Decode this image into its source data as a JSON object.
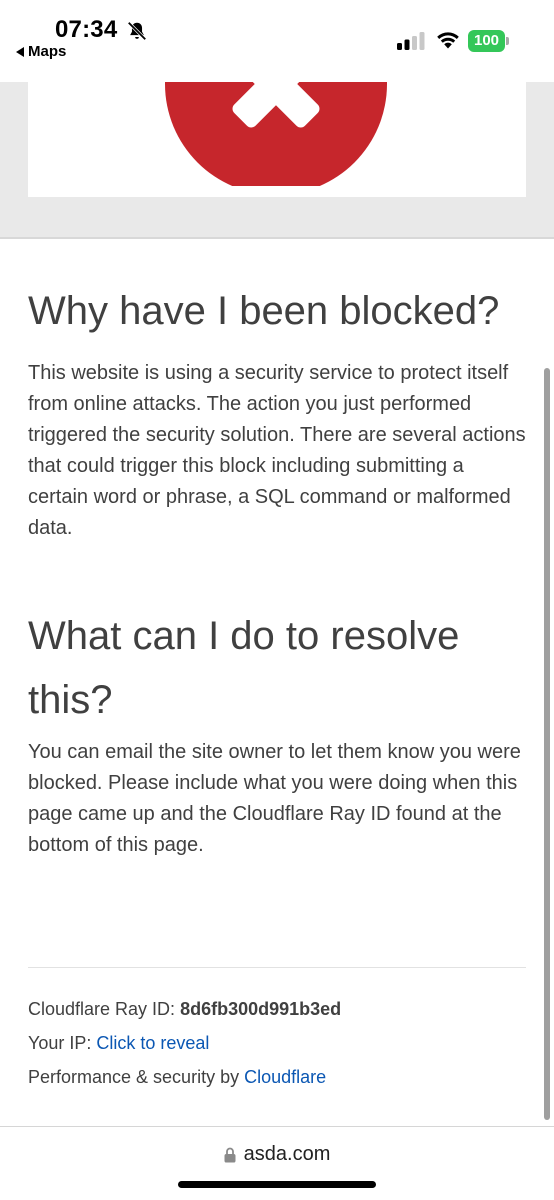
{
  "status_bar": {
    "time": "07:34",
    "back_app": "Maps",
    "battery": "100"
  },
  "icons": {
    "bell": "bell-slash-icon",
    "signal": "cellular-signal-icon",
    "wifi": "wifi-icon",
    "battery": "battery-icon",
    "error": "error-x-icon",
    "lock": "lock-icon"
  },
  "colors": {
    "error_red": "#c6262c",
    "link_blue": "#0b57b3",
    "battery_green": "#34c759"
  },
  "main": {
    "heading_why": "Why have I been blocked?",
    "paragraph_why": "This website is using a security service to protect itself from online attacks. The action you just performed triggered the security solution. There are several actions that could trigger this block including submitting a certain word or phrase, a SQL command or malformed data.",
    "heading_resolve": "What can I do to resolve this?",
    "paragraph_resolve": "You can email the site owner to let them know you were blocked. Please include what you were doing when this page came up and the Cloudflare Ray ID found at the bottom of this page."
  },
  "footer": {
    "ray_label": "Cloudflare Ray ID: ",
    "ray_id": "8d6fb300d991b3ed",
    "ip_label": "Your IP: ",
    "ip_link": "Click to reveal",
    "perf_label": "Performance & security by ",
    "perf_link": "Cloudflare"
  },
  "url_bar": {
    "domain": "asda.com"
  }
}
